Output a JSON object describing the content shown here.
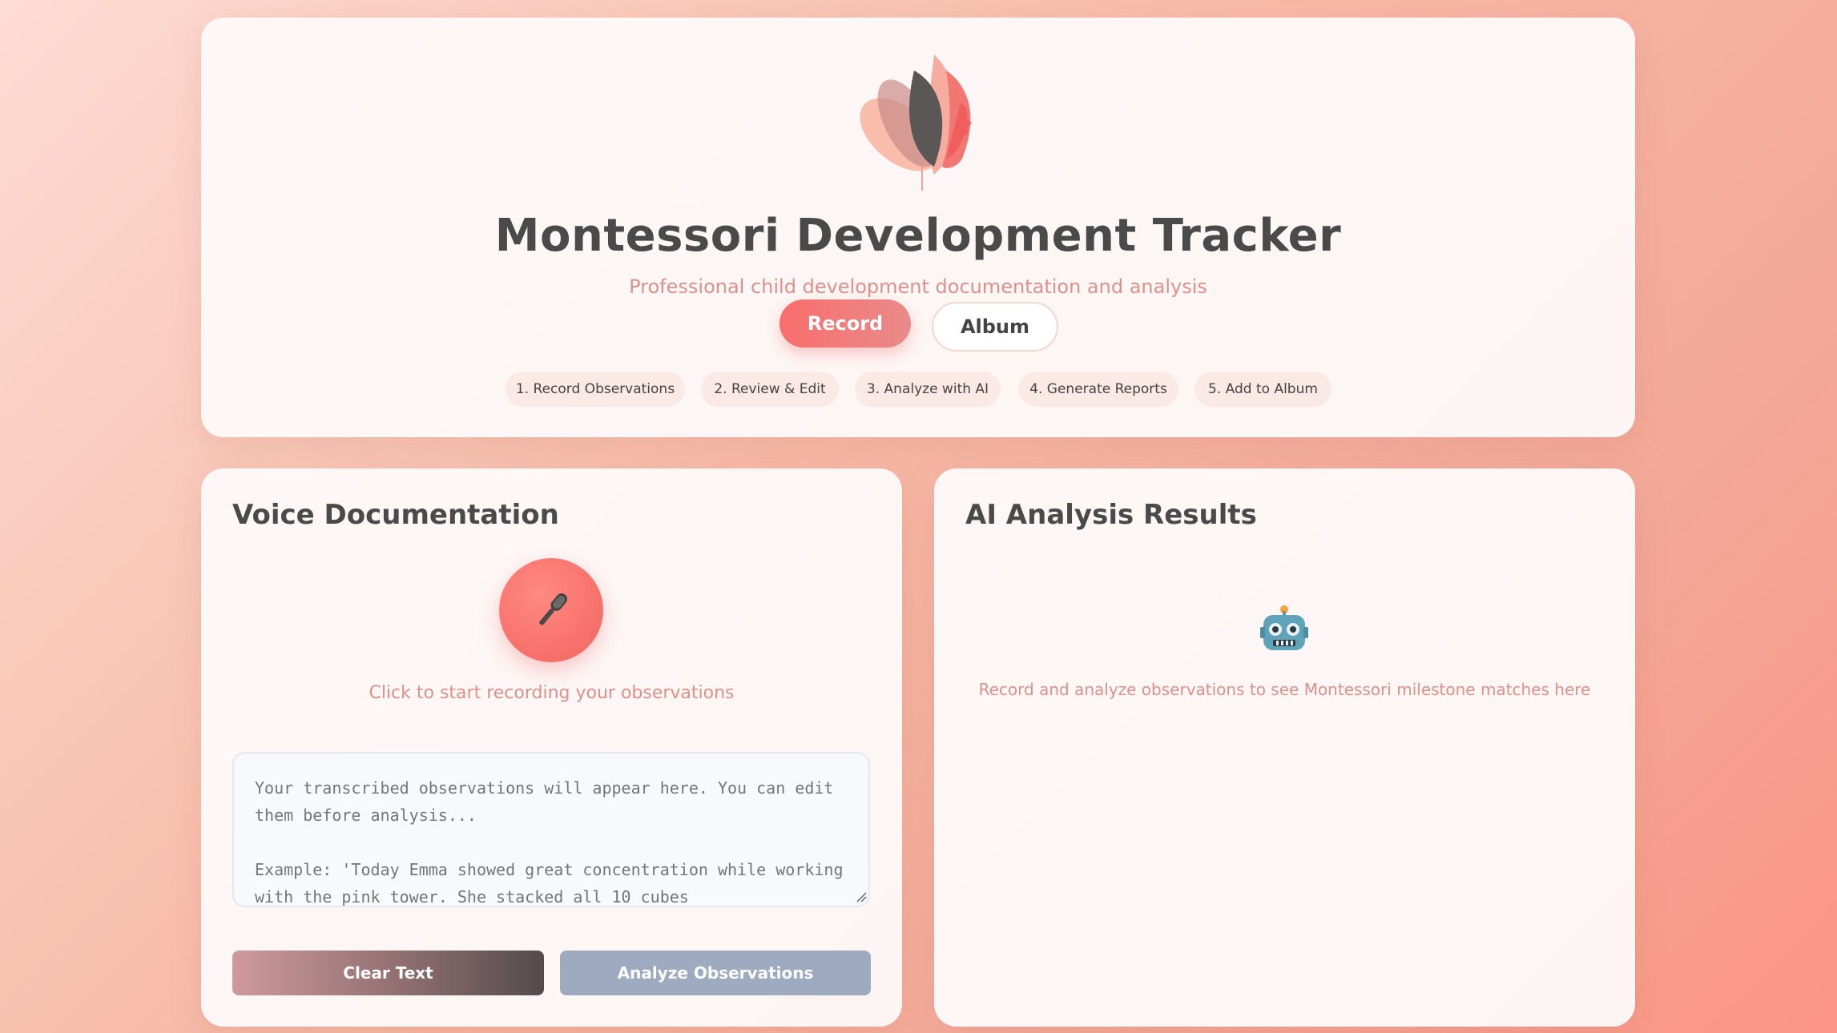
{
  "header": {
    "title": "Montessori Development Tracker",
    "subtitle": "Professional child development documentation and analysis",
    "nav": {
      "record_label": "Record",
      "album_label": "Album"
    },
    "steps": [
      "1. Record Observations",
      "2. Review & Edit",
      "3. Analyze with AI",
      "4. Generate Reports",
      "5. Add to Album"
    ]
  },
  "voice": {
    "title": "Voice Documentation",
    "mic_icon": "microphone-icon",
    "hint": "Click to start recording your observations",
    "transcript_placeholder": "Your transcribed observations will appear here. You can edit them before analysis...\n\nExample: 'Today Emma showed great concentration while working with the pink tower. She stacked all 10 cubes",
    "clear_label": "Clear Text",
    "analyze_label": "Analyze Observations"
  },
  "ai": {
    "title": "AI Analysis Results",
    "icon": "robot-icon",
    "placeholder": "Record and analyze observations to see Montessori milestone matches here"
  },
  "colors": {
    "accent": "#f8736d",
    "title_text": "#4a4a4a",
    "muted_text": "#e0908a",
    "disabled_button": "#9eaac0"
  }
}
